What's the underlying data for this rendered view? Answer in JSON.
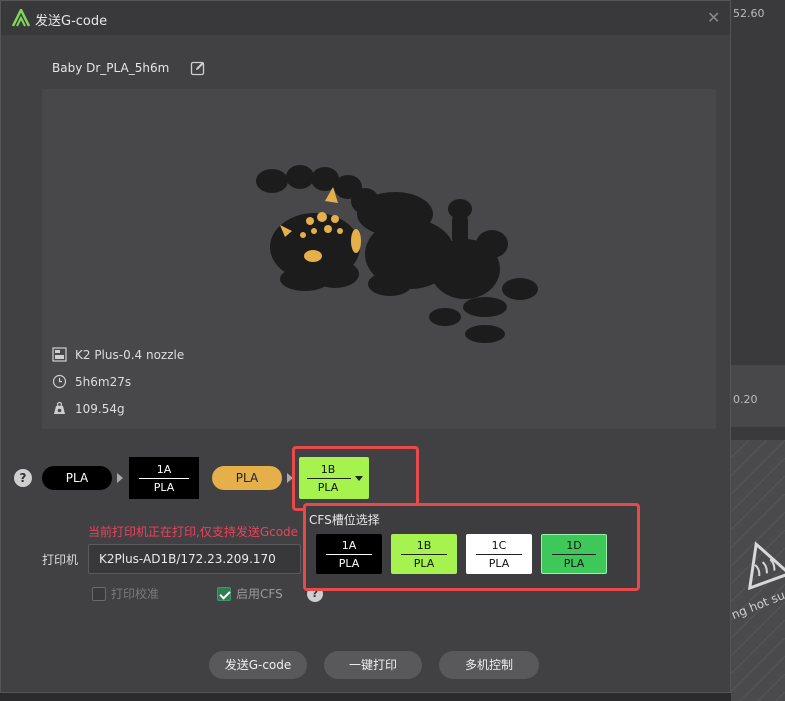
{
  "background": {
    "top_value": "52.60",
    "mid_value": "0.20",
    "bed_text": "ng hot su"
  },
  "dialog": {
    "title": "发送G-code",
    "close_glyph": "✕"
  },
  "file": {
    "name": "Baby Dr_PLA_5h6m"
  },
  "preview": {
    "printer_nozzle": "K2 Plus-0.4 nozzle",
    "print_time": "5h6m27s",
    "weight": "109.54g"
  },
  "mapping": {
    "help_glyph": "?",
    "source1_material": "PLA",
    "target1_slot": "1A",
    "target1_material": "PLA",
    "source2_material": "PLA",
    "target2_slot": "1B",
    "target2_material": "PLA"
  },
  "colors": {
    "black": "#000000",
    "gold": "#e5b04a",
    "lime": "#a6f24f",
    "white": "#ffffff",
    "green": "#3ec85a",
    "warning": "#e8435b",
    "highlight": "#e84a4a"
  },
  "warning": "当前打印机正在打印,仅支持发送Gcode",
  "printer": {
    "label": "打印机",
    "value": "K2Plus-AD1B/172.23.209.170",
    "calibrate_label": "打印校准",
    "calibrate_checked": false,
    "cfs_label": "启用CFS",
    "cfs_checked": true
  },
  "cfs_popup": {
    "title": "CFS槽位选择",
    "slots": [
      {
        "id": "1A",
        "material": "PLA"
      },
      {
        "id": "1B",
        "material": "PLA"
      },
      {
        "id": "1C",
        "material": "PLA"
      },
      {
        "id": "1D",
        "material": "PLA"
      }
    ]
  },
  "buttons": {
    "send": "发送G-code",
    "one_click_print": "一键打印",
    "multi_control": "多机控制"
  }
}
